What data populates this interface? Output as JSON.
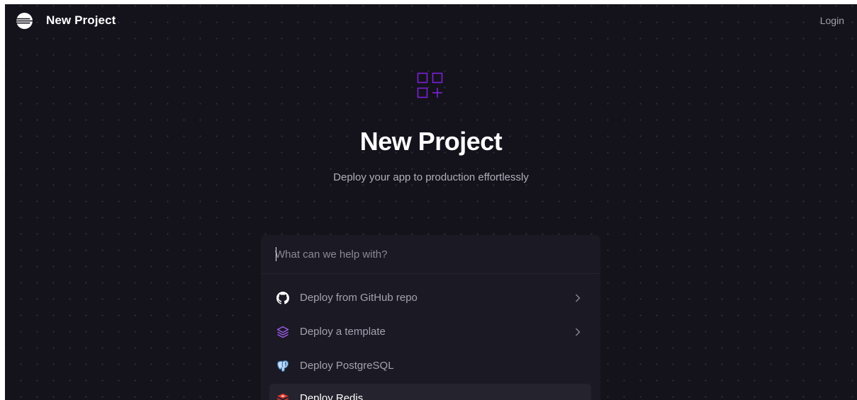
{
  "header": {
    "app_title": "New Project",
    "login_label": "Login",
    "logo_icon": "railway-logo-icon"
  },
  "hero": {
    "icon": "grid-plus-icon",
    "icon_color": "#7b22d6",
    "title": "New Project",
    "subtitle": "Deploy your app to production effortlessly"
  },
  "search": {
    "placeholder": "What can we help with?",
    "value": ""
  },
  "menu": {
    "items": [
      {
        "label": "Deploy from GitHub repo",
        "icon": "github-icon",
        "has_submenu": true,
        "active": false
      },
      {
        "label": "Deploy a template",
        "icon": "layers-icon",
        "has_submenu": true,
        "active": false
      },
      {
        "label": "Deploy PostgreSQL",
        "icon": "postgresql-icon",
        "has_submenu": false,
        "active": false
      },
      {
        "label": "Deploy Redis",
        "icon": "redis-icon",
        "has_submenu": false,
        "active": true
      }
    ]
  },
  "colors": {
    "background": "#14121b",
    "panel": "#1b1924",
    "accent": "#7b22d6",
    "active_row": "#25232e"
  }
}
